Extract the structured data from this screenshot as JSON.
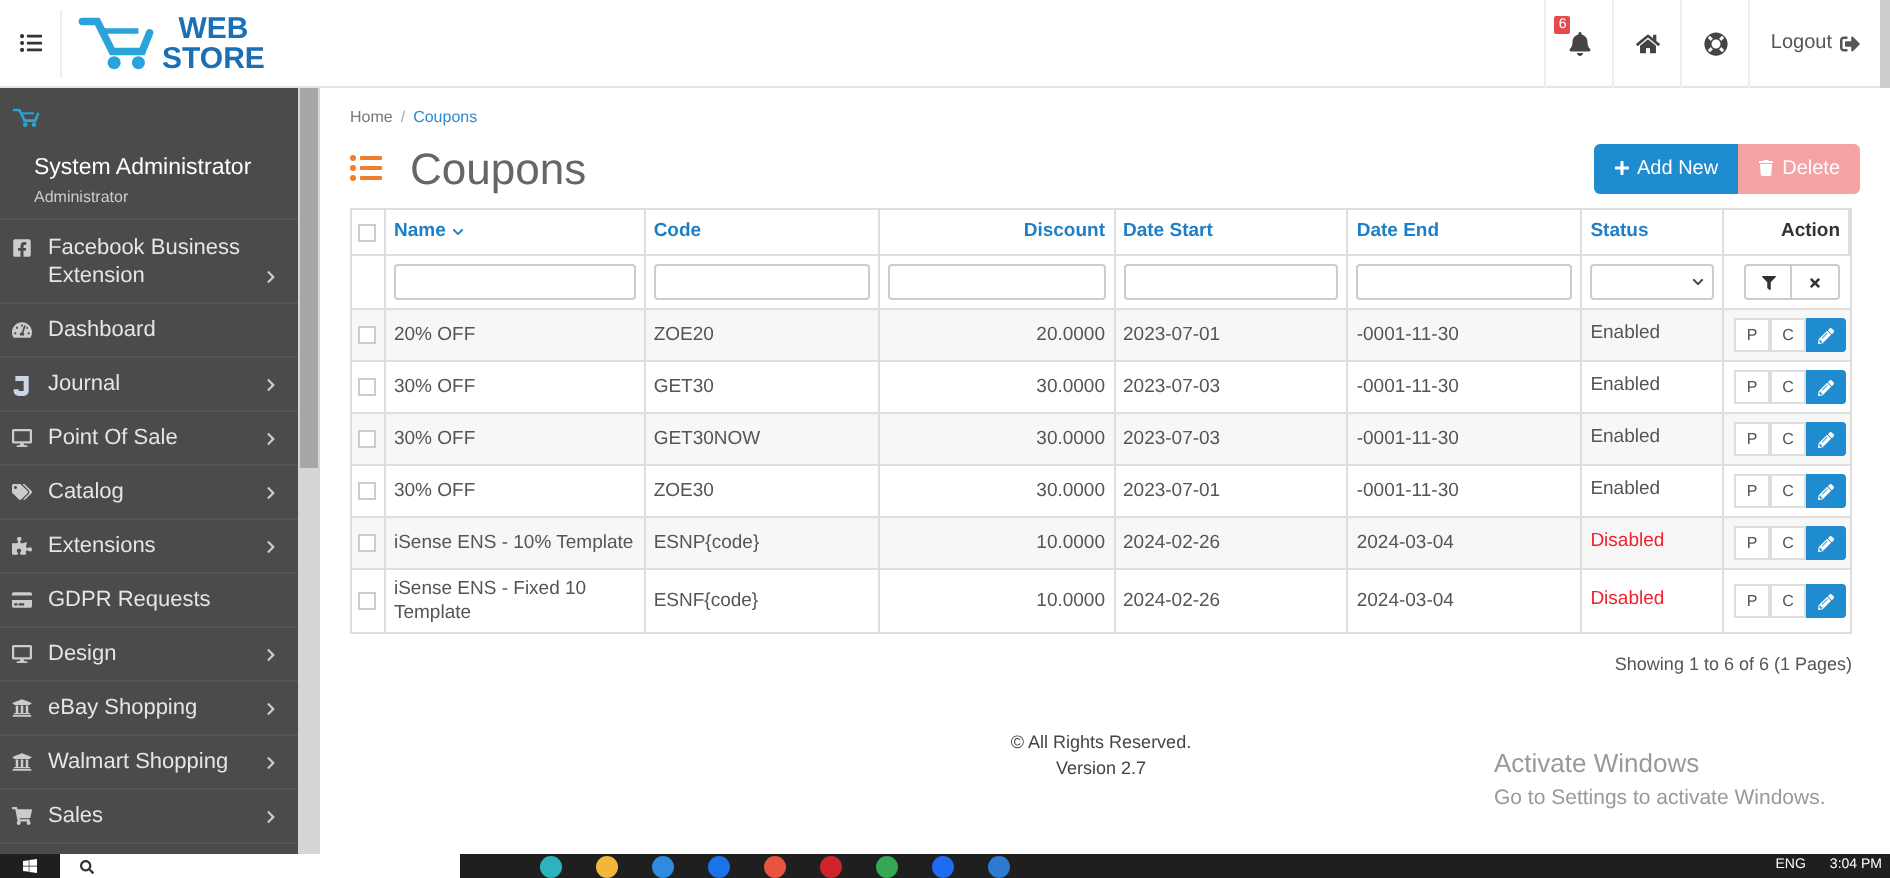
{
  "header": {
    "logo_top": "WEB",
    "logo_bottom": "STORE",
    "notification_count": "6",
    "logout": "Logout"
  },
  "sidebar": {
    "user_name": "System Administrator",
    "user_role": "Administrator",
    "items": [
      {
        "label": "Facebook Business Extension",
        "kind": "facebook",
        "has_submenu": true
      },
      {
        "label": "Dashboard",
        "kind": "dashboard",
        "has_submenu": false
      },
      {
        "label": "Journal",
        "kind": "journal",
        "has_submenu": true
      },
      {
        "label": "Point Of Sale",
        "kind": "monitor",
        "has_submenu": true
      },
      {
        "label": "Catalog",
        "kind": "tag",
        "has_submenu": true
      },
      {
        "label": "Extensions",
        "kind": "puzzle",
        "has_submenu": true
      },
      {
        "label": "GDPR Requests",
        "kind": "card",
        "has_submenu": false
      },
      {
        "label": "Design",
        "kind": "monitor",
        "has_submenu": true
      },
      {
        "label": "eBay Shopping",
        "kind": "bank",
        "has_submenu": true
      },
      {
        "label": "Walmart Shopping",
        "kind": "bank",
        "has_submenu": true
      },
      {
        "label": "Sales",
        "kind": "cart",
        "has_submenu": true
      }
    ]
  },
  "breadcrumb": {
    "items": [
      {
        "label": "Home",
        "selected": false
      },
      {
        "label": "Coupons",
        "selected": true
      }
    ],
    "separator": "/"
  },
  "title": "Coupons",
  "buttons": [
    {
      "label": "Add New",
      "kind": "add",
      "disabled": false
    },
    {
      "label": "Delete",
      "kind": "delete",
      "disabled": true
    }
  ],
  "table": {
    "select_all_checked": false,
    "columns": [
      {
        "label": "Name",
        "sorted": true
      },
      {
        "label": "Code",
        "sorted": false
      },
      {
        "label": "Discount",
        "sorted": false
      },
      {
        "label": "Date Start",
        "sorted": false
      },
      {
        "label": "Date End",
        "sorted": false
      },
      {
        "label": "Status",
        "sorted": false
      },
      {
        "label": "Action",
        "sorted": false
      }
    ],
    "rows": [
      {
        "checked": false,
        "name": "20% OFF",
        "code": "ZOE20",
        "discount": "20.0000",
        "date_start": "2023-07-01",
        "date_end": "-0001-11-30",
        "status": "Enabled",
        "enabled": true,
        "actions": [
          "P",
          "C"
        ]
      },
      {
        "checked": false,
        "name": "30% OFF",
        "code": "GET30",
        "discount": "30.0000",
        "date_start": "2023-07-03",
        "date_end": "-0001-11-30",
        "status": "Enabled",
        "enabled": true,
        "actions": [
          "P",
          "C"
        ]
      },
      {
        "checked": false,
        "name": "30% OFF",
        "code": "GET30NOW",
        "discount": "30.0000",
        "date_start": "2023-07-03",
        "date_end": "-0001-11-30",
        "status": "Enabled",
        "enabled": true,
        "actions": [
          "P",
          "C"
        ]
      },
      {
        "checked": false,
        "name": "30% OFF",
        "code": "ZOE30",
        "discount": "30.0000",
        "date_start": "2023-07-01",
        "date_end": "-0001-11-30",
        "status": "Enabled",
        "enabled": true,
        "actions": [
          "P",
          "C"
        ]
      },
      {
        "checked": false,
        "name": "iSense ENS - 10% Template",
        "code": "ESNP{code}",
        "discount": "10.0000",
        "date_start": "2024-02-26",
        "date_end": "2024-03-04",
        "status": "Disabled",
        "enabled": false,
        "actions": [
          "P",
          "C"
        ]
      },
      {
        "checked": false,
        "name": "iSense ENS - Fixed 10 Template",
        "code": "ESNF{code}",
        "discount": "10.0000",
        "date_start": "2024-02-26",
        "date_end": "2024-03-04",
        "status": "Disabled",
        "enabled": false,
        "actions": [
          "P",
          "C"
        ]
      }
    ]
  },
  "pagination": "Showing 1 to 6 of 6 (1 Pages)",
  "footer": {
    "copyright": "© All Rights Reserved.",
    "version": "Version 2.7"
  },
  "activation": {
    "title": "Activate Windows",
    "subtitle": "Go to Settings to activate Windows."
  },
  "taskbar": {
    "language": "ENG",
    "time": "3:04 PM"
  }
}
